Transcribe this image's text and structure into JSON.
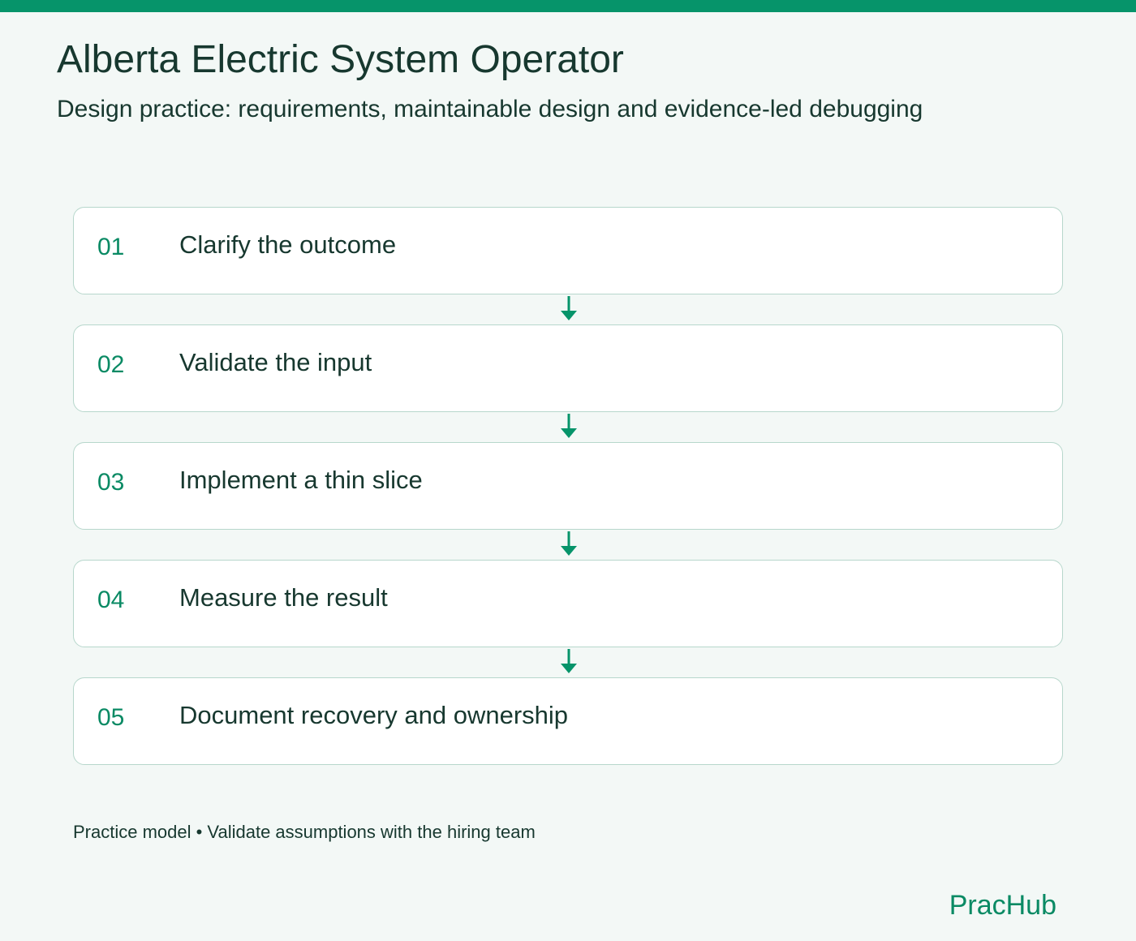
{
  "header": {
    "title": "Alberta Electric System Operator",
    "subtitle": "Design practice: requirements, maintainable design and evidence-led debugging"
  },
  "steps": [
    {
      "number": "01",
      "label": "Clarify the outcome"
    },
    {
      "number": "02",
      "label": "Validate the input"
    },
    {
      "number": "03",
      "label": "Implement a thin slice"
    },
    {
      "number": "04",
      "label": "Measure the result"
    },
    {
      "number": "05",
      "label": "Document recovery and ownership"
    }
  ],
  "footer": {
    "note": "Practice model • Validate assumptions with the hiring team",
    "brand": "PracHub"
  },
  "colors": {
    "accent": "#06946a",
    "text": "#17382f",
    "background": "#f3f8f6",
    "card_border": "#b7d7cc"
  }
}
